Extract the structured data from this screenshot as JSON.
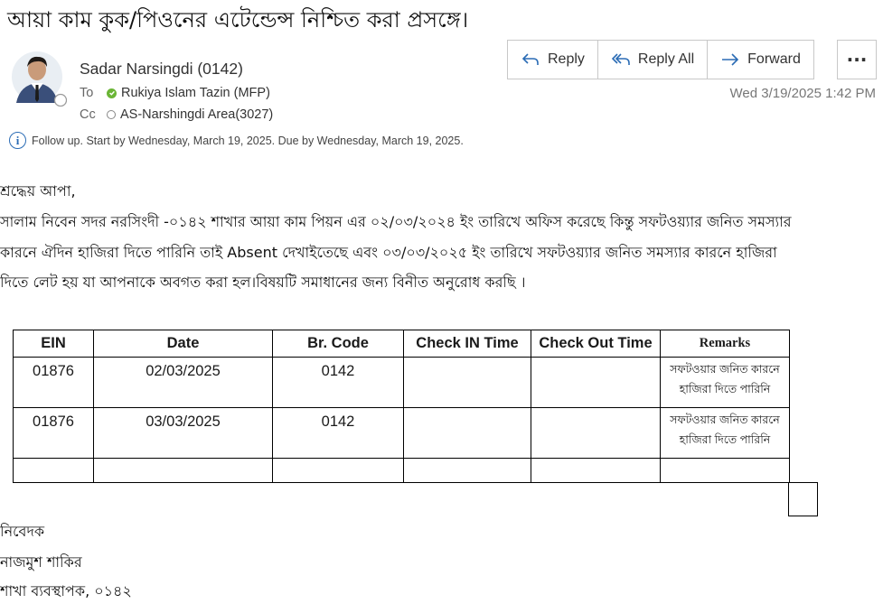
{
  "subject": "আয়া কাম কুক/পিওনের এটেন্ডেন্স নিশ্চিত করা প্রসঙ্গে।",
  "sender": "Sadar Narsingdi (0142)",
  "to_label": "To",
  "to_value": "Rukiya Islam Tazin (MFP)",
  "cc_label": "Cc",
  "cc_value": "AS-Narshingdi Area(3027)",
  "datetime": "Wed 3/19/2025 1:42 PM",
  "actions": {
    "reply": "Reply",
    "reply_all": "Reply All",
    "forward": "Forward",
    "more": "···"
  },
  "followup": "Follow up.  Start by Wednesday, March 19, 2025.  Due by Wednesday, March 19, 2025.",
  "body": {
    "greeting": "শ্রদ্ধেয় আপা,",
    "line1": "সালাম নিবেন সদর নরসিংদী -০১৪২ শাখার আয়া কাম পিয়ন এর ০২/০৩/২০২৪ ইং তারিখে অফিস করেছে কিন্তু সফটওয়্যার জনিত সমস্যার",
    "line2": "কারনে ঐদিন হাজিরা দিতে পারিনি তাই Absent দেখাইতেছে এবং ০৩/০৩/২০২৫ ইং তারিখে সফটওয়্যার জনিত সমস্যার কারনে হাজিরা",
    "line3": "দিতে লেট হয় যা আপনাকে অবগত করা হল।বিষয়টি সমাধানের জন্য বিনীত অনুরোধ করছি ।",
    "closing1": "নিবেদক",
    "closing2": "নাজমুশ শাকির",
    "closing3": "শাখা ব্যবস্থাপক, ০১৪২"
  },
  "table": {
    "headers": [
      "EIN",
      "Date",
      "Br. Code",
      "Check IN Time",
      "Check Out Time",
      "Remarks"
    ],
    "rows": [
      {
        "ein": "01876",
        "date": "02/03/2025",
        "code": "0142",
        "in": "",
        "out": "",
        "rem1": "সফটওয়ার জনিত কারনে",
        "rem2": "হাজিরা দিতে পারিনি"
      },
      {
        "ein": "01876",
        "date": "03/03/2025",
        "code": "0142",
        "in": "",
        "out": "",
        "rem1": "সফটওয়ার জনিত কারনে",
        "rem2": "হাজিরা দিতে পারিনি"
      }
    ]
  },
  "colors": {
    "accent": "#2b6cb5",
    "presence": "#6bb536"
  }
}
